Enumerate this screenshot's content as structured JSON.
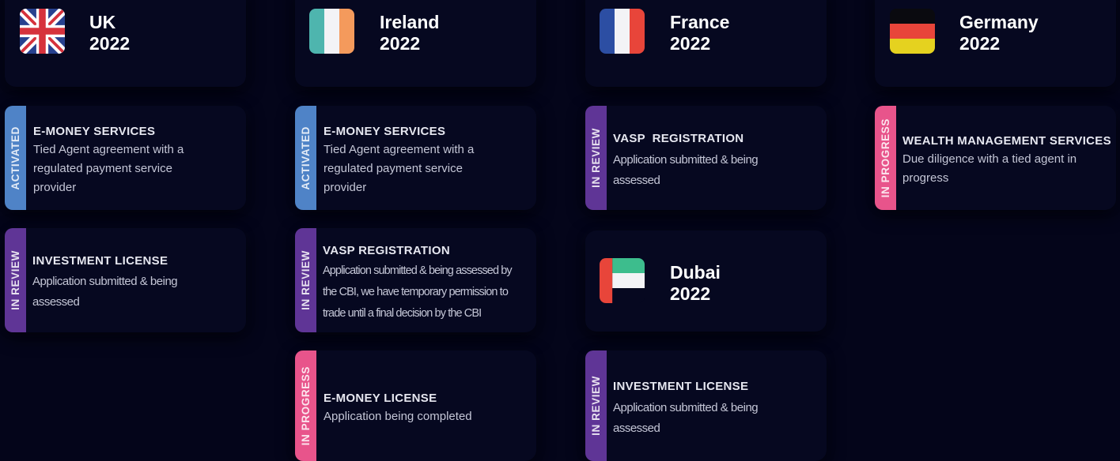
{
  "countries": {
    "uk": {
      "title": "UK\n2022",
      "flag_icon": "uk-flag-icon",
      "licenses": [
        {
          "status": "ACTIVATED",
          "title": "E-MONEY SERVICES",
          "description": "Tied Agent agreement with a regulated payment service provider"
        },
        {
          "status": "IN REVIEW",
          "title": "INVESTMENT LICENSE",
          "description": "Application submitted & being assessed"
        }
      ]
    },
    "ireland": {
      "title": "Ireland\n2022",
      "flag_icon": "ireland-flag-icon",
      "licenses": [
        {
          "status": "ACTIVATED",
          "title": "E-MONEY SERVICES",
          "description": "Tied Agent agreement with a regulated payment service provider"
        },
        {
          "status": "IN REVIEW",
          "title": "VASP REGISTRATION",
          "description": "Application submitted & being assessed by the CBI, we have temporary permission to trade until a final decision by the CBI"
        },
        {
          "status": "IN PROGRESS",
          "title": "E-MONEY LICENSE",
          "description": "Application being completed"
        }
      ]
    },
    "france": {
      "title": "France\n2022",
      "flag_icon": "france-flag-icon",
      "licenses": [
        {
          "status": "IN REVIEW",
          "title": "VASP  REGISTRATION",
          "description": "Application submitted & being assessed"
        }
      ]
    },
    "germany": {
      "title": "Germany\n2022",
      "flag_icon": "germany-flag-icon",
      "licenses": [
        {
          "status": "IN PROGRESS",
          "title": "WEALTH MANAGEMENT SERVICES",
          "description": "Due diligence with a tied agent in progress"
        }
      ]
    },
    "dubai": {
      "title": "Dubai\n2022",
      "flag_icon": "uae-flag-icon",
      "licenses": [
        {
          "status": "IN REVIEW",
          "title": "INVESTMENT LICENSE",
          "description": "Application submitted & being assessed"
        }
      ]
    }
  },
  "colors": {
    "background": "#04051a",
    "card": "#060820",
    "activated": "#4f83c7",
    "in_review": "#5f3596",
    "in_progress": "#e8548b"
  }
}
